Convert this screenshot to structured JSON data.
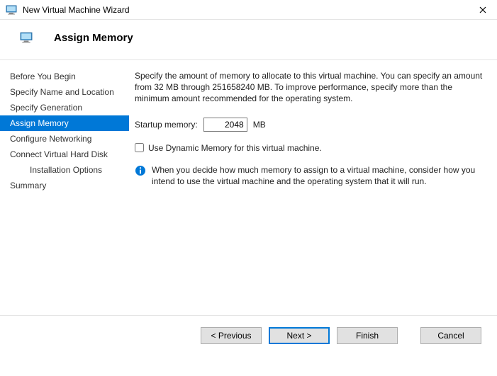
{
  "window": {
    "title": "New Virtual Machine Wizard"
  },
  "header": {
    "title": "Assign Memory"
  },
  "steps": [
    {
      "label": "Before You Begin"
    },
    {
      "label": "Specify Name and Location"
    },
    {
      "label": "Specify Generation"
    },
    {
      "label": "Assign Memory",
      "selected": true
    },
    {
      "label": "Configure Networking"
    },
    {
      "label": "Connect Virtual Hard Disk"
    },
    {
      "label": "Installation Options",
      "sub": true
    },
    {
      "label": "Summary"
    }
  ],
  "content": {
    "description": "Specify the amount of memory to allocate to this virtual machine. You can specify an amount from 32 MB through 251658240 MB. To improve performance, specify more than the minimum amount recommended for the operating system.",
    "startup_label": "Startup memory:",
    "startup_value": "2048",
    "startup_unit": "MB",
    "dynamic_label": "Use Dynamic Memory for this virtual machine.",
    "info_text": "When you decide how much memory to assign to a virtual machine, consider how you intend to use the virtual machine and the operating system that it will run."
  },
  "buttons": {
    "previous": "< Previous",
    "next": "Next >",
    "finish": "Finish",
    "cancel": "Cancel"
  }
}
